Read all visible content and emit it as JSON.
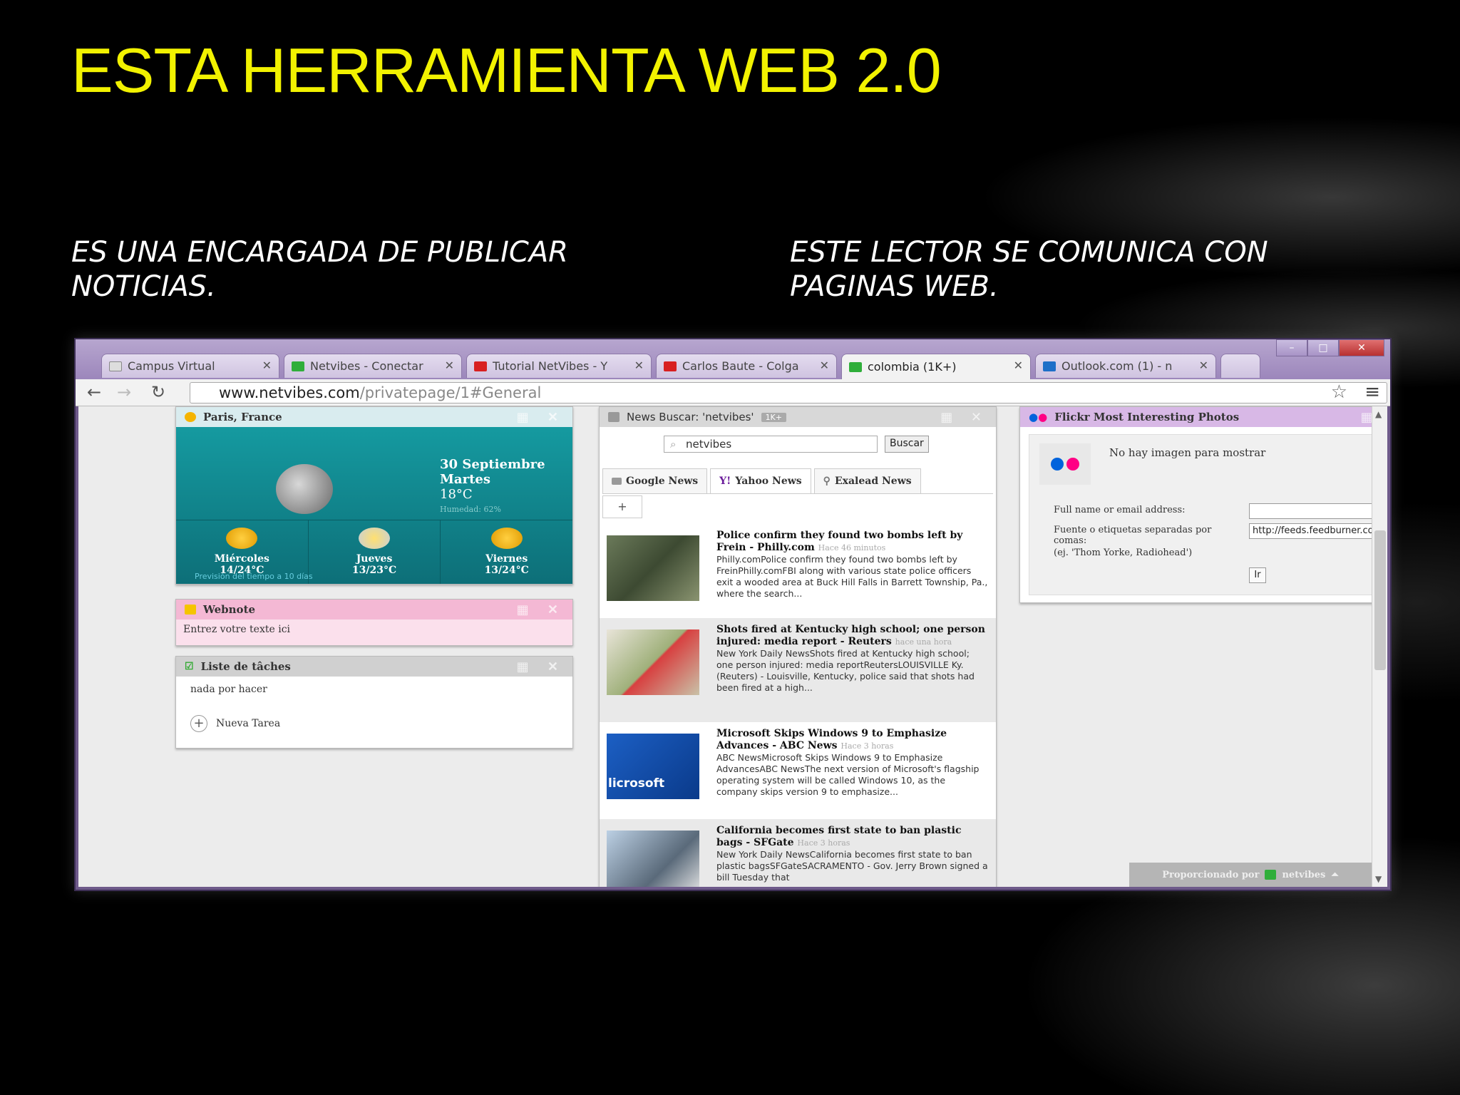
{
  "slide": {
    "title": "ESTA HERRAMIENTA WEB 2.0",
    "left_text": "ES UNA ENCARGADA DE PUBLICAR NOTICIAS.",
    "right_text": "ESTE LECTOR SE COMUNICA CON PAGINAS  WEB.",
    "title_color": "#f2f200"
  },
  "browser": {
    "tabs": [
      {
        "label": "Campus Virtual",
        "icon": "campus-icon"
      },
      {
        "label": "Netvibes - Conectar",
        "icon": "netvibes-icon"
      },
      {
        "label": "Tutorial NetVibes - Y",
        "icon": "youtube-icon"
      },
      {
        "label": "Carlos Baute - Colga",
        "icon": "youtube-icon"
      },
      {
        "label": "colombia (1K+)",
        "icon": "netvibes-icon"
      },
      {
        "label": "Outlook.com (1) - n",
        "icon": "outlook-icon"
      }
    ],
    "url_host": "www.netvibes.com",
    "url_path": "/privatepage/1#General"
  },
  "weather": {
    "location": "Paris, France",
    "date": "30 Septiembre",
    "weekday": "Martes",
    "temp": "18°C",
    "small_text": "Humedad: 62%",
    "days": [
      {
        "name": "Miércoles",
        "range": "14/24°C"
      },
      {
        "name": "Jueves",
        "range": "13/23°C"
      },
      {
        "name": "Viernes",
        "range": "13/24°C"
      }
    ],
    "forecast_link": "Previsión del tiempo a 10 días"
  },
  "webnote": {
    "title": "Webnote",
    "text": "Entrez votre texte ici"
  },
  "tasks": {
    "title": "Liste de tâches",
    "empty": "nada por hacer",
    "new_task": "Nueva Tarea"
  },
  "news": {
    "title": "News Buscar: 'netvibes'",
    "badge": "1K+",
    "search_value": "netvibes",
    "search_button": "Buscar",
    "tabs": [
      "Google News",
      "Yahoo News",
      "Exalead News"
    ],
    "add_tab": "+",
    "articles": [
      {
        "title": "Police confirm they found two bombs left by Frein - Philly.com",
        "time": "Hace 46 minutos",
        "body": "Philly.comPolice confirm they found two bombs left by FreinPhilly.comFBI along with various state police officers exit a wooded area at Buck Hill Falls in Barrett Township, Pa., where the search..."
      },
      {
        "title": "Shots fired at Kentucky high school; one person injured: media report - Reuters",
        "time": "hace una hora",
        "body": "New York Daily NewsShots fired at Kentucky high school; one person injured: media reportReutersLOUISVILLE Ky. (Reuters) - Louisville, Kentucky, police said that shots had been fired at a high..."
      },
      {
        "title": "Microsoft Skips Windows 9 to Emphasize Advances - ABC News",
        "time": "Hace 3 horas",
        "body": "ABC NewsMicrosoft Skips Windows 9 to Emphasize AdvancesABC NewsThe next version of Microsoft's flagship operating system will be called Windows 10, as the company skips version 9 to emphasize..."
      },
      {
        "title": "California becomes first state to ban plastic bags - SFGate",
        "time": "Hace 3 horas",
        "body": "New York Daily NewsCalifornia becomes first state to ban plastic bagsSFGateSACRAMENTO - Gov. Jerry Brown signed a bill Tuesday that"
      }
    ],
    "image_text": "licrosoft"
  },
  "flickr": {
    "title": "Flickr Most Interesting Photos",
    "no_image": "No hay imagen para mostrar",
    "label_name": "Full name or email address:",
    "label_tags": "Fuente o etiquetas separadas por comas:",
    "label_example": "(ej. 'Thom Yorke, Radiohead')",
    "tags_value": "http://feeds.feedburner.co",
    "go_button": "Ir"
  },
  "footer": {
    "powered": "Proporcionado por",
    "brand": "netvibes"
  }
}
